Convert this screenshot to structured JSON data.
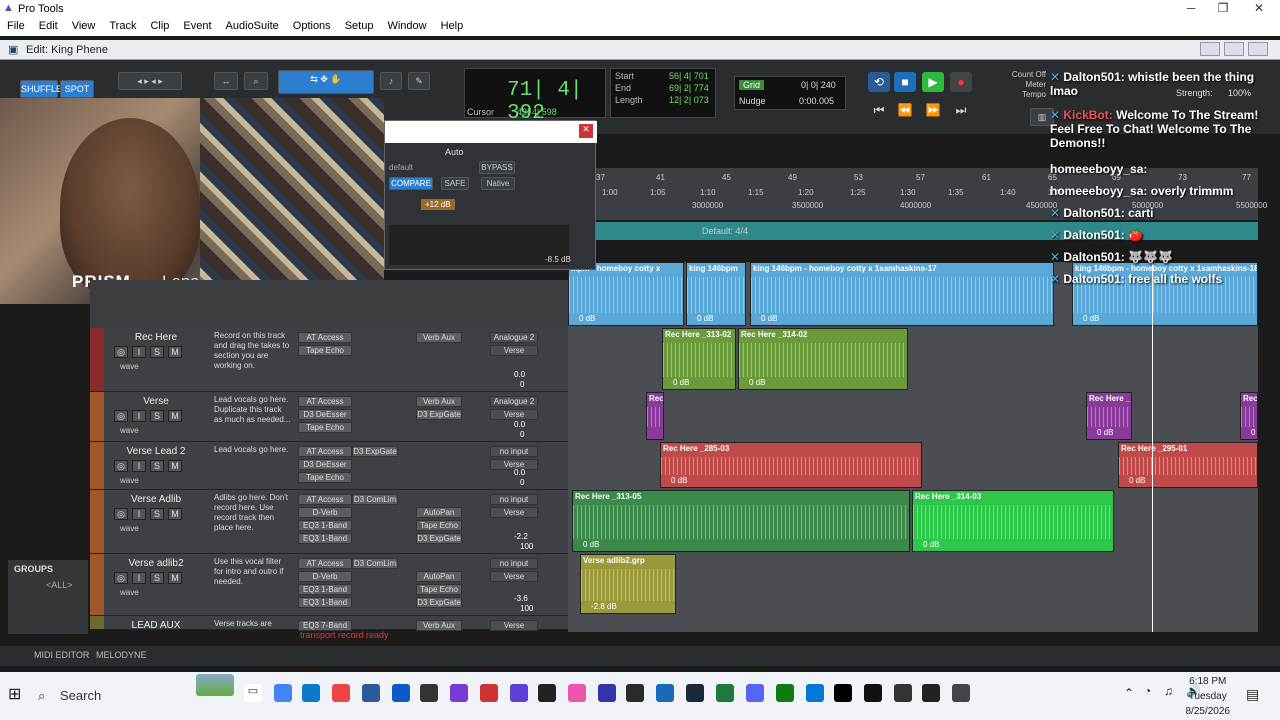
{
  "window": {
    "title": "Pro Tools",
    "edit_title": "Edit: King Phene"
  },
  "menu": [
    "File",
    "Edit",
    "View",
    "Track",
    "Clip",
    "Event",
    "AudioSuite",
    "Options",
    "Setup",
    "Window",
    "Help"
  ],
  "toolbar": {
    "shuffle": "SHUFFLE",
    "spot": "SPOT"
  },
  "counter": {
    "main": "71| 4| 392",
    "cursor_label": "Cursor",
    "cursor_value": "43| 4| 598"
  },
  "selection": {
    "start_label": "Start",
    "end_label": "End",
    "length_label": "Length",
    "start": "56| 4| 701",
    "end": "69| 2| 774",
    "length": "12| 2| 073"
  },
  "grid": {
    "grid_label": "Grid",
    "grid_value": "0| 0| 240",
    "nudge_label": "Nudge",
    "nudge_value": "0:00.005"
  },
  "meter": {
    "count_off": "Count Off",
    "meter": "Meter",
    "tempo": "Tempo",
    "strength_label": "Strength:",
    "strength_value": "100%"
  },
  "plugin": {
    "auto": "Auto",
    "bypass": "BYPASS",
    "compare": "COMPARE",
    "safe": "SAFE",
    "native": "Native",
    "gain": "+12 dB",
    "gain_reading": "-8.5 dB",
    "preset": "default"
  },
  "webcam": {
    "label": "PRISM",
    "label2": "Lens"
  },
  "ruler": {
    "bars": [
      "37",
      "41",
      "45",
      "49",
      "53",
      "57",
      "61",
      "65",
      "69",
      "73",
      "77"
    ],
    "times": [
      "1:00",
      "1:05",
      "1:10",
      "1:15",
      "1:20",
      "1:25",
      "1:30",
      "1:35",
      "1:40",
      "1:45",
      "1:50"
    ],
    "samples": [
      "3000000",
      "3500000",
      "4000000",
      "4500000",
      "5000000",
      "5500000"
    ],
    "meter_label": "Default: 4/4"
  },
  "tracks": [
    {
      "name": "Rec Here",
      "comment": "Record on this track and drag the takes to section you are working on.",
      "inserts": [
        "AT Access",
        "Tape Echo"
      ],
      "sends": [
        "Verb Aux"
      ],
      "io": [
        "Analogue 2",
        "Verse"
      ],
      "vol": "0.0",
      "pan": "0",
      "vol_label": "vol",
      "pan_label": "pan"
    },
    {
      "name": "Verse",
      "comment": "Lead vocals go here. Duplicate this track as much as needed...",
      "inserts": [
        "AT Access",
        "D3 DeEsser",
        "Tape Echo"
      ],
      "sends": [
        "Verb Aux",
        "D3 ExpGate"
      ],
      "io": [
        "Analogue 2",
        "Verse"
      ],
      "vol": "0.0",
      "pan": "0"
    },
    {
      "name": "Verse Lead 2",
      "comment": "Lead vocals go here.",
      "inserts": [
        "AT Access",
        "D3 DeEsser",
        "Tape Echo"
      ],
      "sends": [
        "D3 ExpGate"
      ],
      "io": [
        "no input",
        "Verse"
      ],
      "vol": "0.0",
      "pan": "0"
    },
    {
      "name": "Verse Adlib",
      "comment": "Adlibs go here. Don't record here. Use record track then place here.",
      "inserts": [
        "AT Access",
        "D-Verb",
        "EQ3 1-Band",
        "EQ3 1-Band"
      ],
      "sends": [
        "D3 ComLim",
        "AutoPan",
        "Tape Echo",
        "D3 ExpGate"
      ],
      "io": [
        "no input",
        "Verse"
      ],
      "vol": "-2.2",
      "pan": "100"
    },
    {
      "name": "Verse adlib2",
      "comment": "Use this vocal filter for intro and outro if needed.",
      "inserts": [
        "AT Access",
        "D-Verb",
        "EQ3 1-Band",
        "EQ3 1-Band"
      ],
      "sends": [
        "D3 ComLim",
        "AutoPan",
        "Tape Echo",
        "D3 ExpGate"
      ],
      "io": [
        "no input",
        "Verse"
      ],
      "vol": "-3.6",
      "pan": "100"
    },
    {
      "name": "LEAD AUX",
      "comment": "Verse tracks are",
      "inserts": [
        "EQ3 7-Band"
      ],
      "sends": [
        "Verb Aux"
      ],
      "io": [
        "Verse"
      ],
      "vol": "",
      "pan": ""
    }
  ],
  "track_misc": {
    "wave": "wave",
    "rec": "rec",
    "transport_status": "transport record ready",
    "vol_alt": "100"
  },
  "clips": [
    {
      "name": "...pm - homeboy cotty x",
      "db": "0 dB"
    },
    {
      "name": "king 146bpm",
      "db": "0 dB"
    },
    {
      "name": "king 146bpm - homeboy cotty x 1samhaskins-17",
      "db": "0 dB"
    },
    {
      "name": "king 146bpm - homeboy cotty x 1samhaskins-18",
      "db": "0 dB"
    },
    {
      "name": "Rec Here _313-02",
      "db": "0 dB"
    },
    {
      "name": "Rec Here _314-02",
      "db": "0 dB"
    },
    {
      "name": "Rec",
      "db": ""
    },
    {
      "name": "Rec Here _",
      "db": "0 dB"
    },
    {
      "name": "Rec",
      "db": "0"
    },
    {
      "name": "Rec Here _285-03",
      "db": "0 dB"
    },
    {
      "name": "Rec Here _295-01",
      "db": "0 dB"
    },
    {
      "name": "Rec Here _313-05",
      "db": "0 dB"
    },
    {
      "name": "Rec Here _314-03",
      "db": "0 dB"
    },
    {
      "name": "Verse adlib2.grp",
      "db": "-2.8 dB"
    }
  ],
  "chat": [
    {
      "user": "Dalton501:",
      "msg": "whistle been the thing lmao"
    },
    {
      "user": "KickBot:",
      "msg": "Welcome To The Stream! Feel Free To Chat! Welcome To The Demons!!"
    },
    {
      "user": "homeeeboyy_sa:",
      "msg": ""
    },
    {
      "user": "homeeeboyy_sa:",
      "msg": "overly trimmm"
    },
    {
      "user": "Dalton501:",
      "msg": "carti"
    },
    {
      "user": "Dalton501:",
      "msg": "🍅"
    },
    {
      "user": "Dalton501:",
      "msg": "🐺🐺🐺"
    },
    {
      "user": "Dalton501:",
      "msg": "free all the wolfs"
    }
  ],
  "groups": {
    "title": "GROUPS",
    "all": "<ALL>"
  },
  "bottom": {
    "midi": "MIDI EDITOR",
    "melodyne": "MELODYNE"
  },
  "taskbar": {
    "search": "Search",
    "time": "6:18 PM",
    "day": "Tuesday",
    "date": "8/25/2026"
  }
}
